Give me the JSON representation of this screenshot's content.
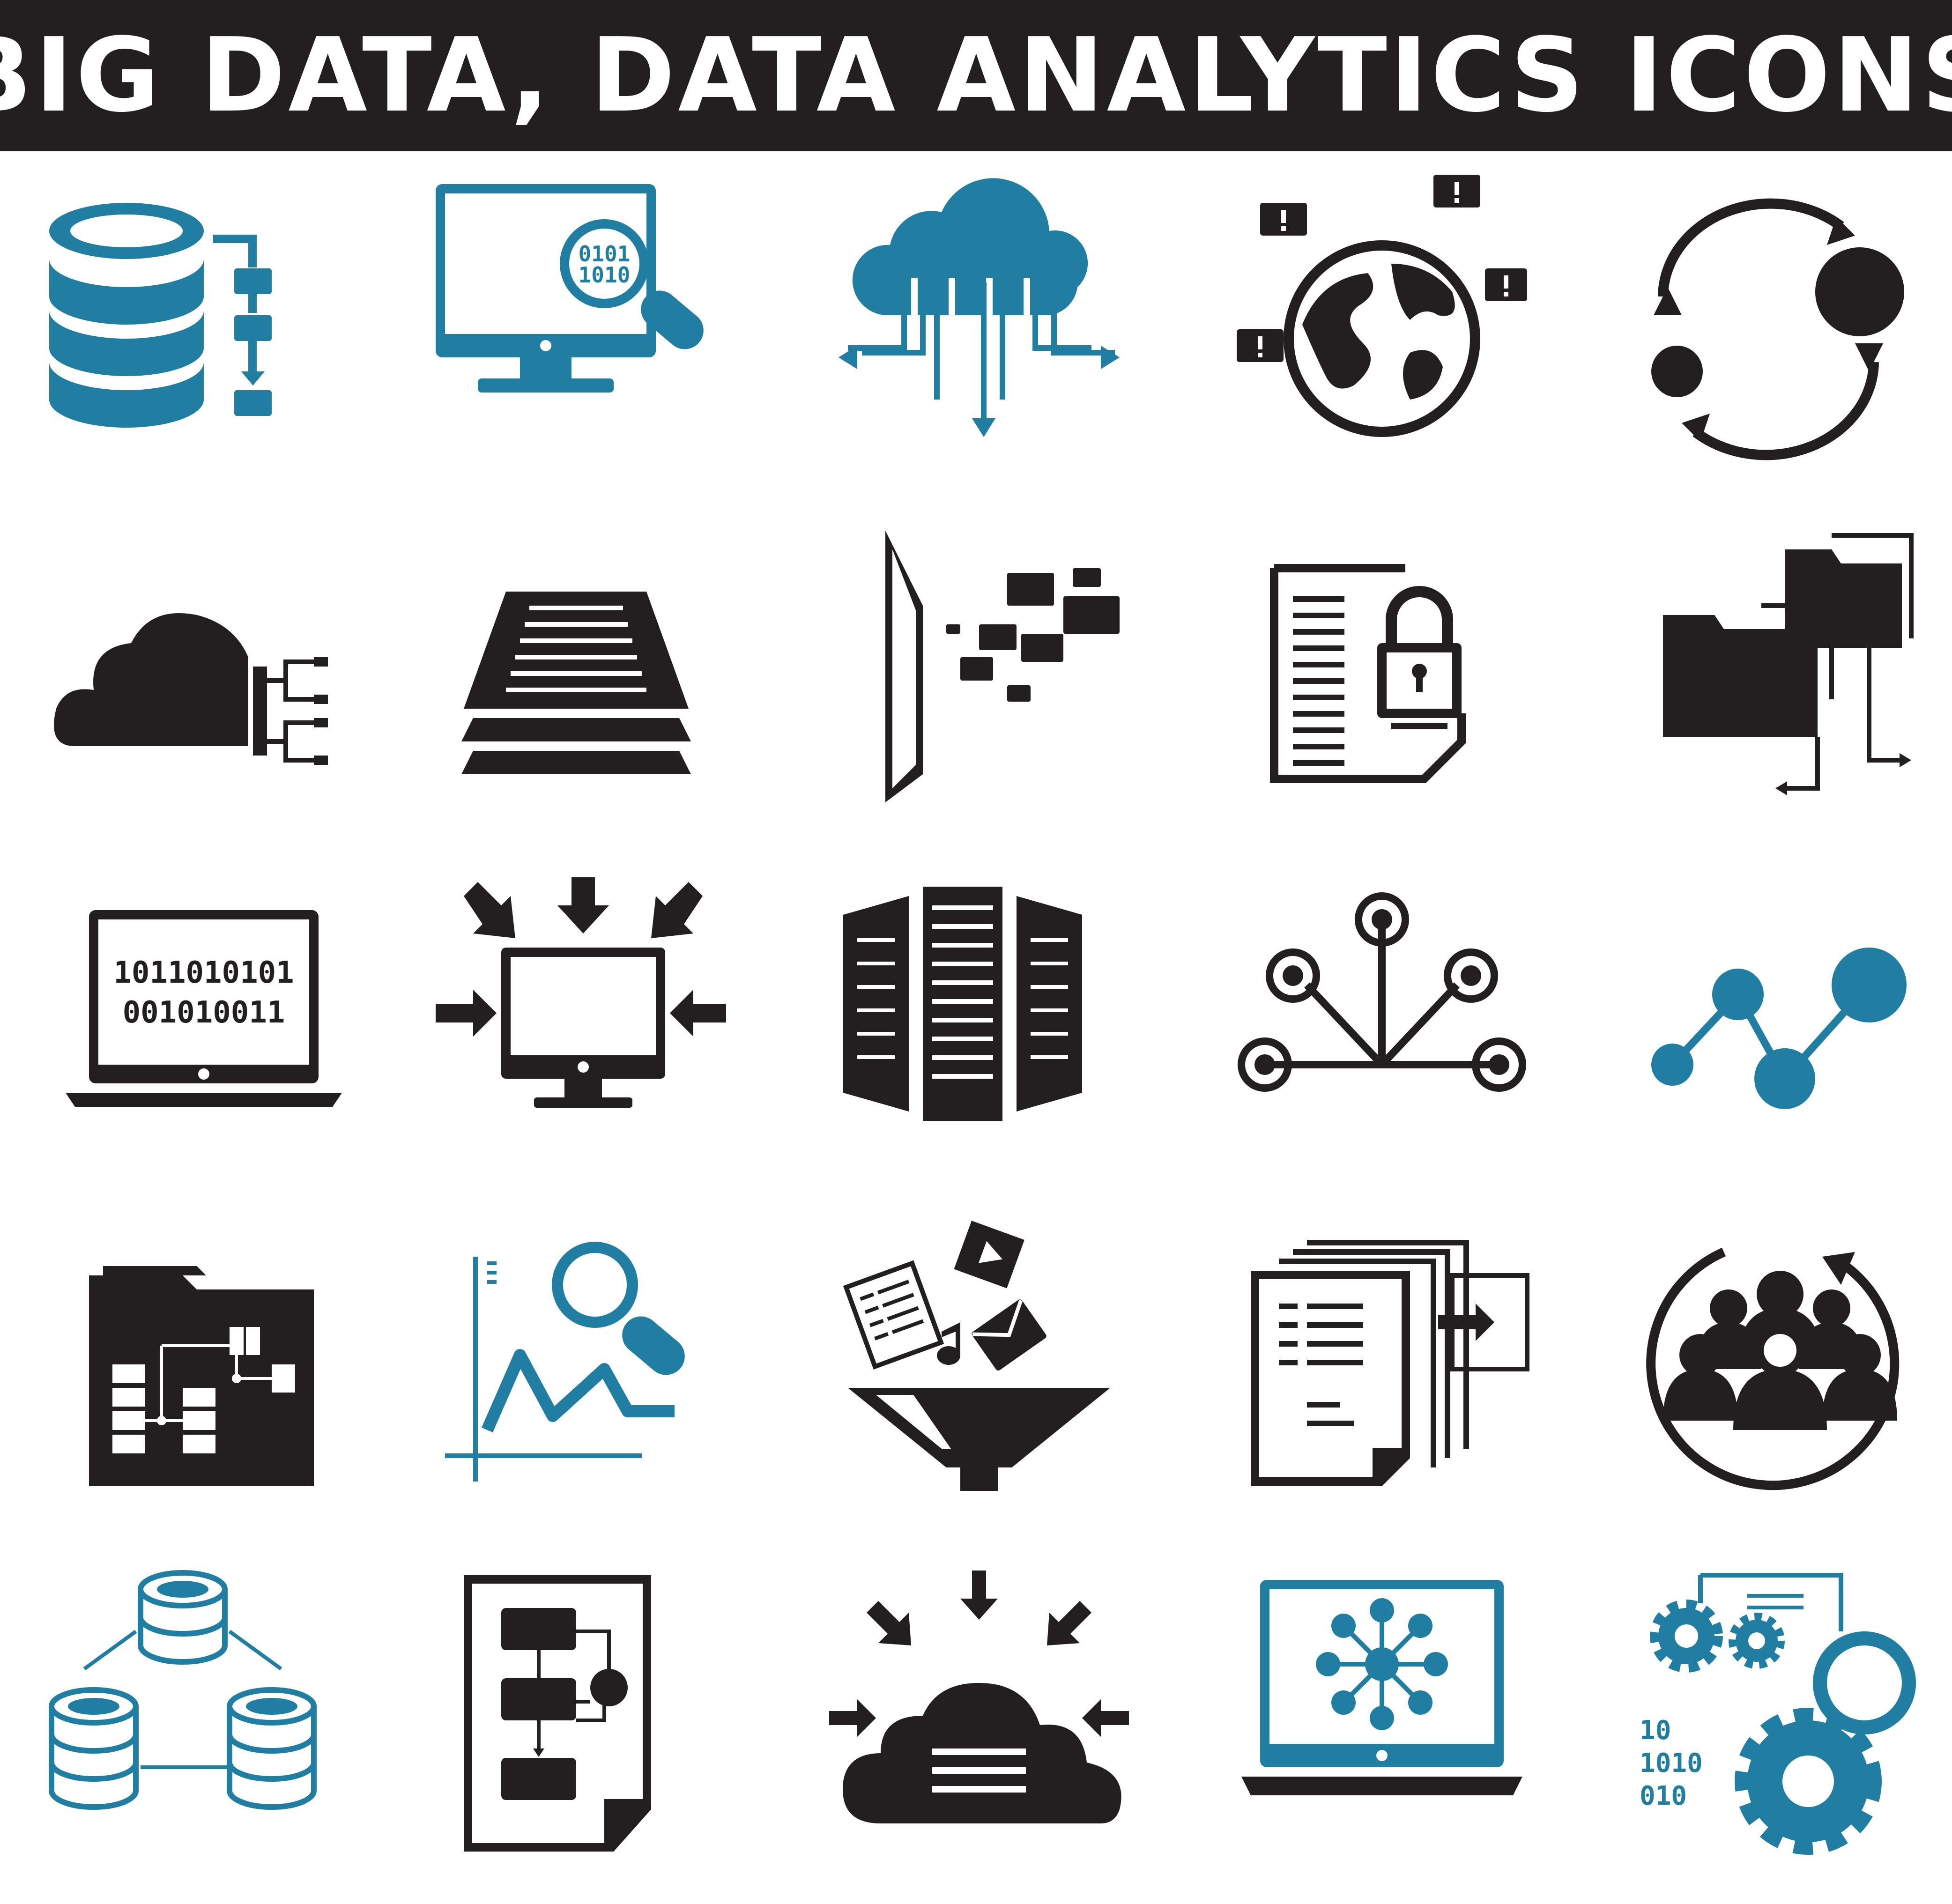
{
  "header": {
    "title": "BIG DATA, DATA ANALYTICS ICONS"
  },
  "colors": {
    "dark": "#231f20",
    "blue": "#1f7ea1",
    "background": "#ffffff"
  },
  "icons": {
    "database_flow": {
      "binary_text": ""
    },
    "monitor_search": {
      "binary_line1": "0101",
      "binary_line2": "1010"
    },
    "laptop_binary": {
      "binary_line1": "1011010101",
      "binary_line2": "001010011"
    },
    "code_gears": {
      "binary_line1": "10",
      "binary_line2": "1010",
      "binary_line3": "010"
    }
  },
  "icon_names": [
    "database-flowchart-icon",
    "monitor-binary-search-icon",
    "cloud-distribution-icon",
    "globe-notifications-icon",
    "sync-cycle-icon",
    "cloud-network-icon",
    "stacked-layers-icon",
    "tablet-email-stream-icon",
    "document-lock-icon",
    "folder-network-icon",
    "laptop-binary-icon",
    "monitor-input-icon",
    "server-racks-icon",
    "node-hub-icon",
    "connected-nodes-graph-icon",
    "folder-flowchart-icon",
    "chart-search-icon",
    "data-funnel-icon",
    "documents-export-icon",
    "team-cycle-icon",
    "database-cluster-icon",
    "flowchart-document-icon",
    "cloud-input-icon",
    "laptop-network-icon",
    "code-gears-icon"
  ]
}
